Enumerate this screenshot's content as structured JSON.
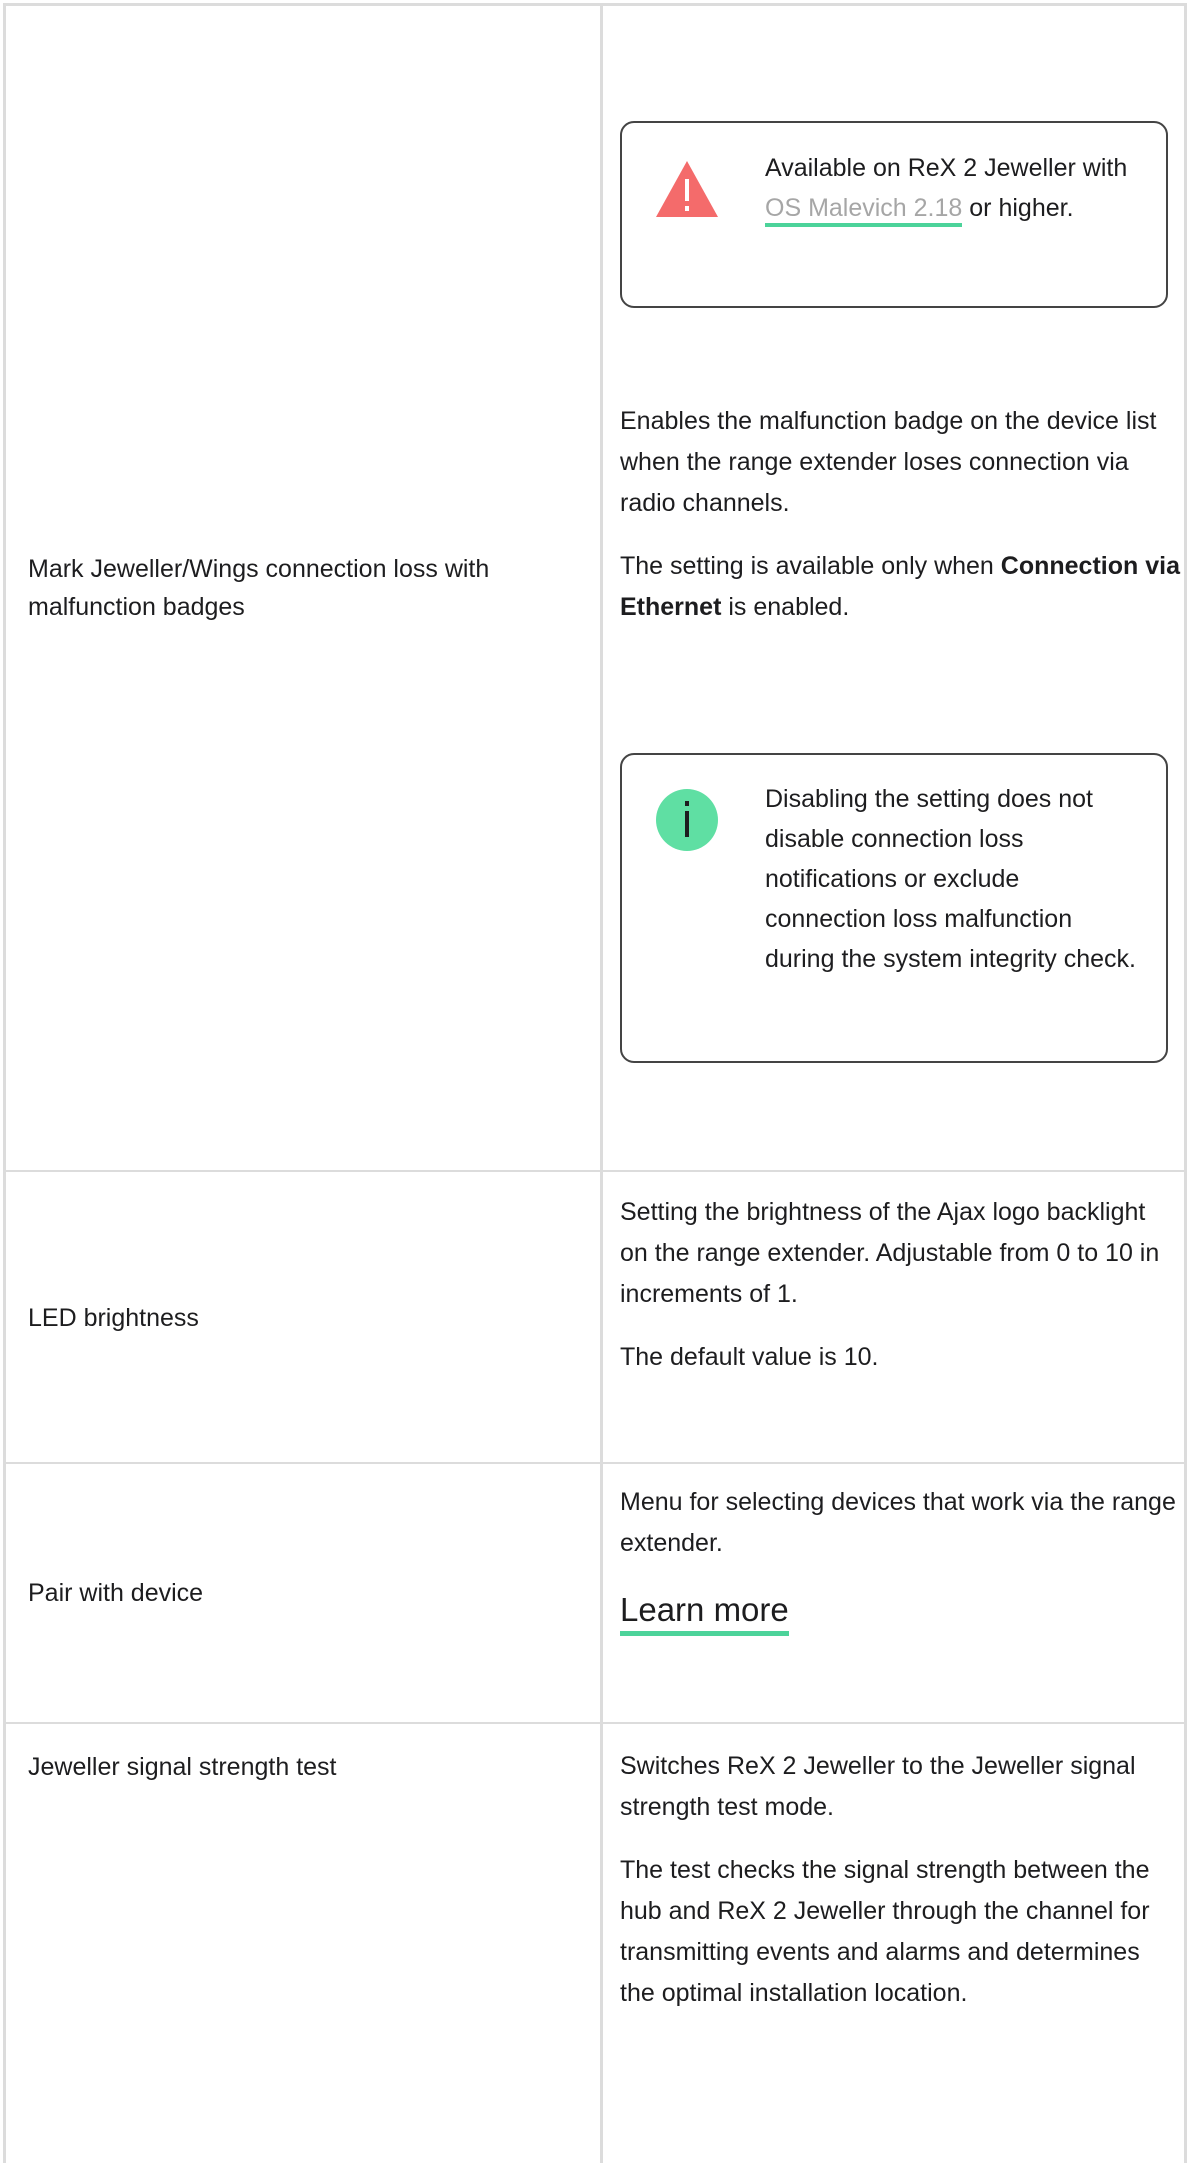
{
  "rows": [
    {
      "setting": "Mark Jeweller/Wings connection loss with malfunction badges",
      "warning_note": {
        "icon": "warning-triangle-icon",
        "icon_color": "#f46b6b",
        "text_before": "Available on ReX 2 Jeweller with",
        "link": "OS Malevich 2.18",
        "text_after": "or higher."
      },
      "description_p1": "Enables the malfunction badge on the device list when the range extender loses connection via radio channels.",
      "description_p2_before": "The setting is available only when",
      "description_p2_bold": "Connection via Ethernet",
      "description_p2_after": "is enabled.",
      "info_note": {
        "icon": "info-circle-icon",
        "icon_color": "#5fdfa3",
        "text": "Disabling the setting does not disable connection loss notifications or exclude connection loss malfunction during the system integrity check."
      }
    },
    {
      "setting": "LED brightness",
      "description_p1": "Setting the brightness of the Ajax logo backlight on the range extender. Adjustable from 0 to 10 in increments of 1.",
      "description_p2": "The default value is 10."
    },
    {
      "setting": "Pair with device",
      "description_p1": "Menu for selecting devices that work via the range extender.",
      "link": "Learn more"
    },
    {
      "setting": "Jeweller signal strength test",
      "description_p1": "Switches ReX 2 Jeweller to the Jeweller signal strength test mode.",
      "description_p2": "The test checks the signal strength between the hub and ReX 2 Jeweller through the channel for transmitting events and alarms and determines the optimal installation location."
    }
  ],
  "colors": {
    "border": "#dcdcdc",
    "accent_underline": "#4cd39a",
    "text": "#1d1d1f",
    "link_text": "#a6a6a6"
  }
}
